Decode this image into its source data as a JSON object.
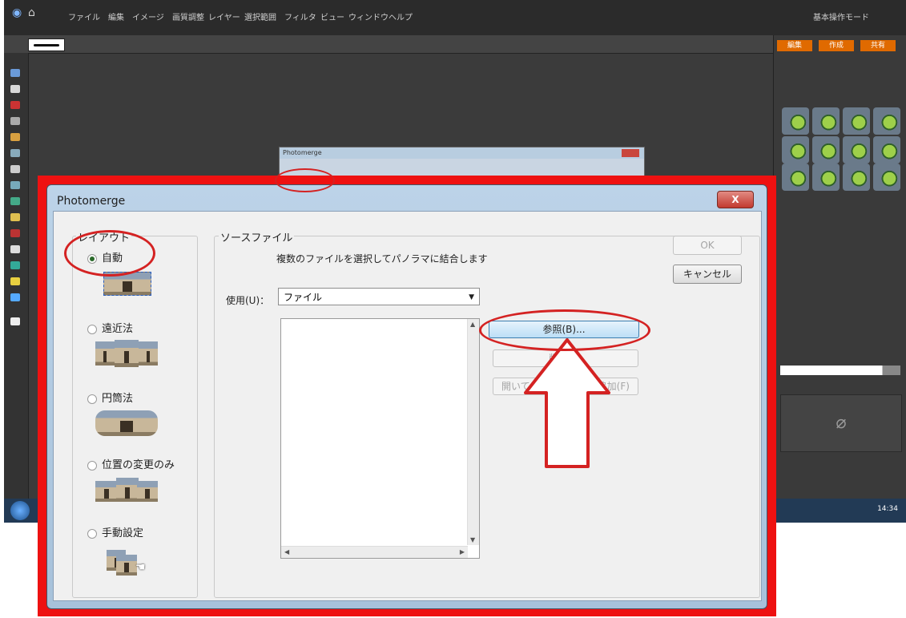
{
  "background_app": {
    "menu_items": [
      "ファイル",
      "編集",
      "イメージ",
      "画質調整",
      "レイヤー",
      "選択範囲",
      "フィルタ",
      "ビュー",
      "ウィンドウ",
      "ヘルプ"
    ],
    "mode_label": "基本操作モード",
    "panel_tabs": [
      "編集",
      "作成",
      "共有"
    ],
    "clock": "14:34"
  },
  "dialog": {
    "title": "Photomerge",
    "close_label": "X"
  },
  "layout": {
    "legend": "レイアウト",
    "options": [
      {
        "label": "自動",
        "selected": true
      },
      {
        "label": "遠近法",
        "selected": false
      },
      {
        "label": "円筒法",
        "selected": false
      },
      {
        "label": "位置の変更のみ",
        "selected": false
      },
      {
        "label": "手動設定",
        "selected": false
      }
    ]
  },
  "source": {
    "legend": "ソースファイル",
    "description": "複数のファイルを選択してパノラマに結合します",
    "use_label": "使用(U)：",
    "use_value": "ファイル",
    "browse_label": "参照(B)...",
    "remove_label": "削除(R)",
    "add_open_label": "開いているファイルを追加(F)"
  },
  "buttons": {
    "ok": "OK",
    "cancel": "キャンセル"
  },
  "annotation": {
    "color": "#d42222",
    "arrow": "up"
  }
}
